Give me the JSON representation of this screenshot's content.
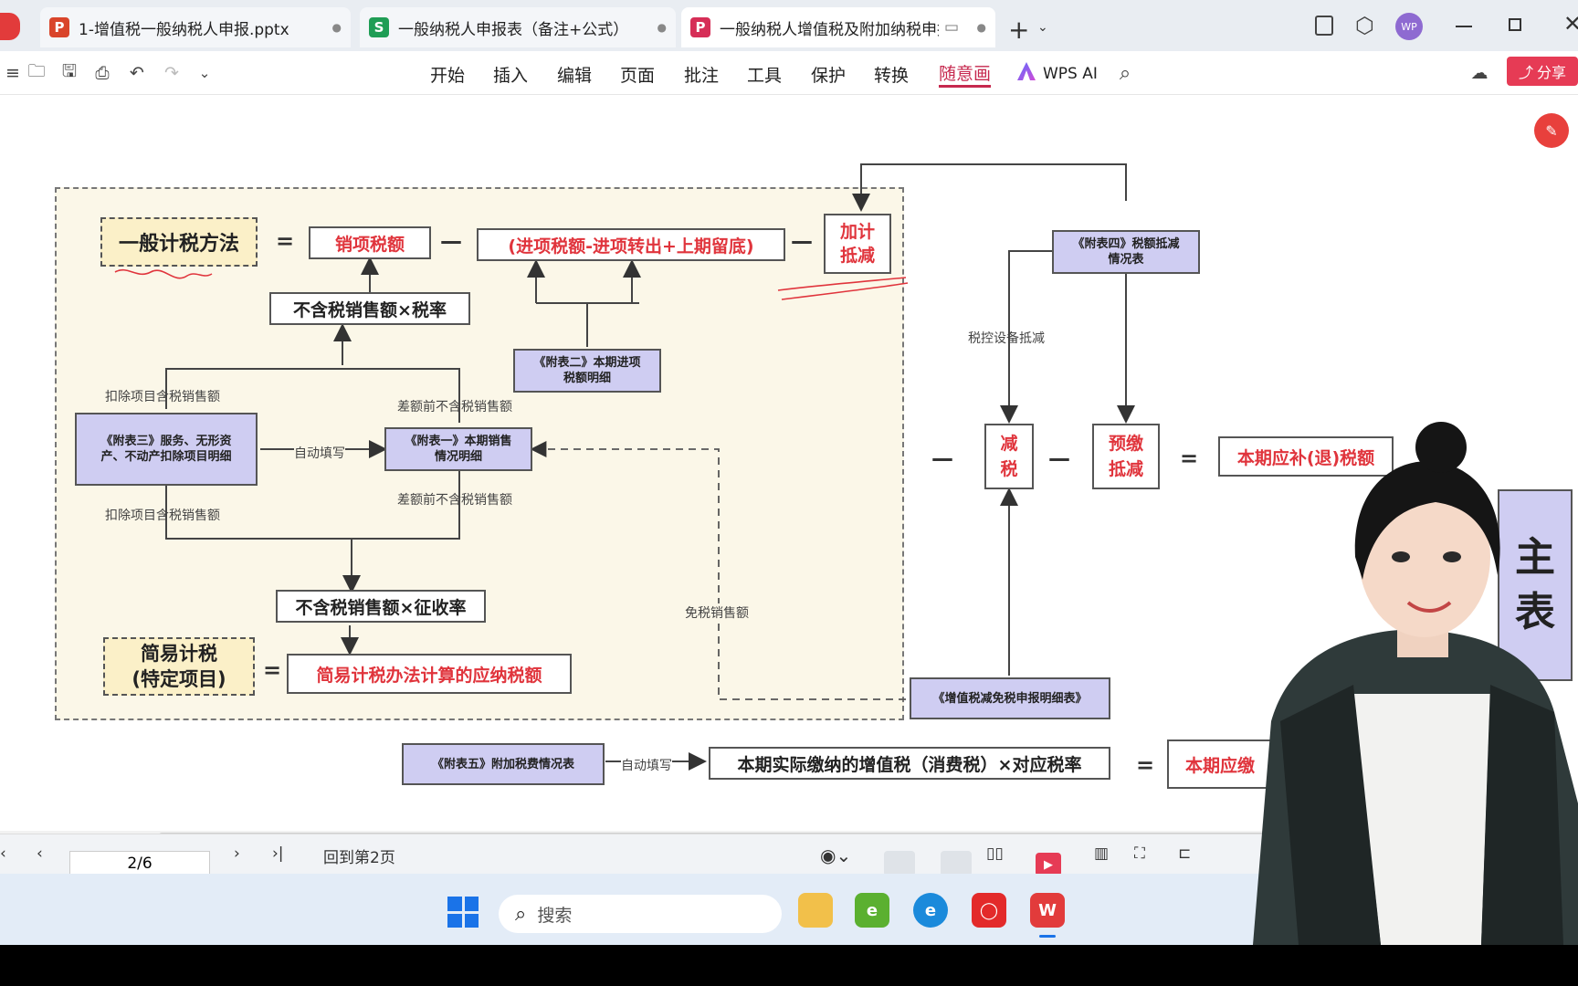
{
  "tabs": [
    {
      "label": "1-增值税一般纳税人申报.pptx",
      "icon": "P",
      "color": "#d9452b"
    },
    {
      "label": "一般纳税人申报表（备注+公式）",
      "icon": "S",
      "color": "#1f9d55"
    },
    {
      "label": "一般纳税人增值税及附加纳税申报",
      "icon": "P",
      "color": "#d62e57"
    }
  ],
  "toolbar": {
    "menus": [
      "开始",
      "插入",
      "编辑",
      "页面",
      "批注",
      "工具",
      "保护",
      "转换",
      "随意画",
      "WPS AI"
    ],
    "share": "分享",
    "avatar": "WP"
  },
  "diagram": {
    "general_method": "一般计税方法",
    "output_tax": "销项税额",
    "input_expr": "(进项税额-进项转出+上期留底)",
    "extra_deduct": "加计抵减",
    "sales_x_rate": "不含税销售额×税率",
    "att2": "《附表二》本期进项税额明细",
    "att3": "《附表三》服务、无形资产、不动产扣除项目明细",
    "att1": "《附表一》本期销售情况明细",
    "deduct_incl_top": "扣除项目含税销售额",
    "deduct_incl_bottom": "扣除项目含税销售额",
    "auto_fill": "自动填写",
    "pre_diff_top": "差额前不含税销售额",
    "pre_diff_bottom": "差额前不含税销售额",
    "sales_x_levy": "不含税销售额×征收率",
    "simple_method": "简易计税(特定项目)",
    "simple_tax": "简易计税办法计算的应纳税额",
    "exempt_sales": "免税销售额",
    "att4": "《附表四》税额抵减情况表",
    "tax_device": "税控设备抵减",
    "reduce_tax": "减税",
    "prepaid_deduct": "预缴抵减",
    "payable": "本期应补(退)税额",
    "exempt_detail": "《增值税减免税申报明细表》",
    "att5": "《附表五》附加税费情况表",
    "auto_fill2": "自动填写",
    "actual_paid": "本期实际缴纳的增值税（消费税）×对应税率",
    "result_cut": "本期应缴",
    "main_table_part": "主表",
    "equal": "=",
    "minus": "—"
  },
  "statusbar": {
    "page_input": "2/6",
    "back_to": "回到第2页"
  },
  "taskbar": {
    "search": "搜索"
  }
}
